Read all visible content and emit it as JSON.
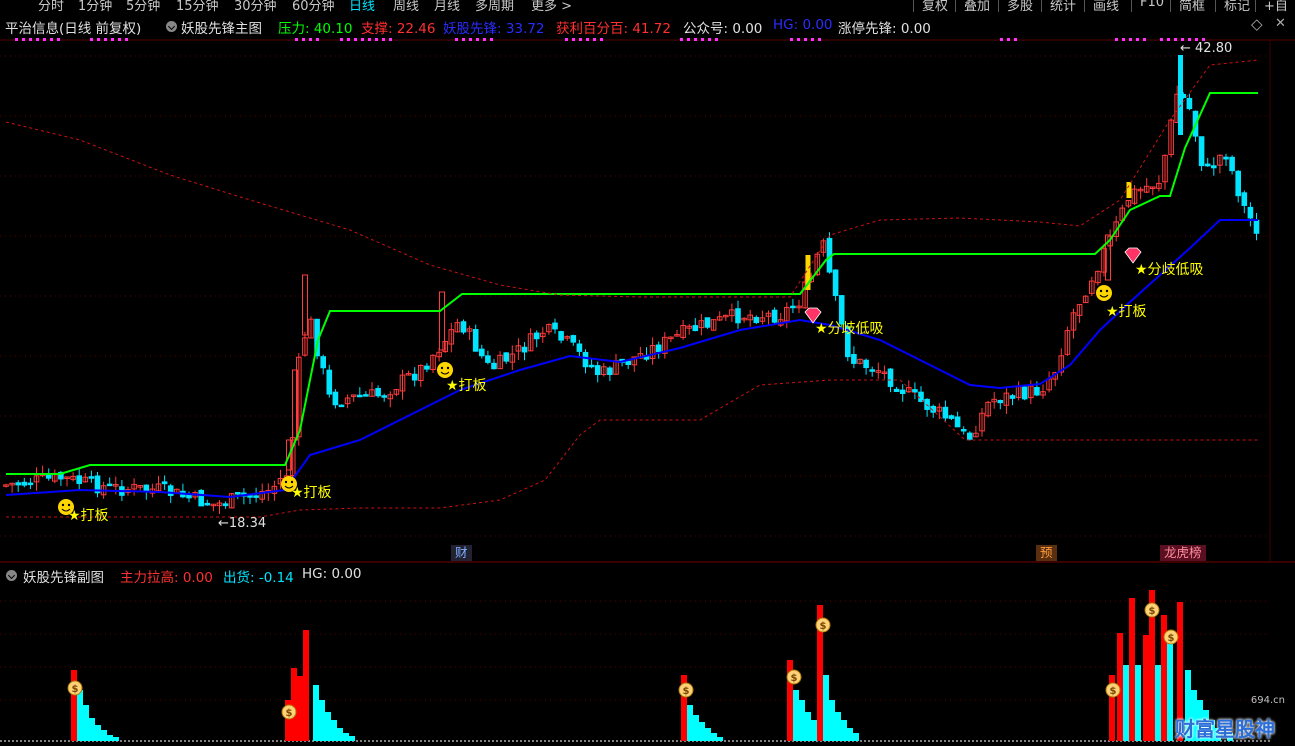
{
  "toolbar": {
    "periods": [
      "分时",
      "1分钟",
      "5分钟",
      "15分钟",
      "30分钟",
      "60分钟",
      "日线",
      "周线",
      "月线",
      "多周期",
      "更多 >"
    ],
    "active_period": "日线",
    "buttons": [
      "复权",
      "叠加",
      "多股",
      "统计",
      "画线",
      "F10",
      "简框",
      "标记",
      "+自选"
    ]
  },
  "main_header": {
    "stock": "平治信息(日线 前复权)",
    "indicator": "妖股先锋主图",
    "pressure": "压力: 40.10",
    "support": "支撑: 22.46",
    "yaogu": "妖股先锋: 33.72",
    "profit": "获利百分百: 41.72",
    "gzh": "公众号: 0.00",
    "hg": "HG: 0.00",
    "zt": "涨停先锋: 0.00"
  },
  "main_chart": {
    "max_label": "42.80",
    "min_label": "18.34",
    "signals": [
      {
        "text": "★打板"
      },
      {
        "text": "★打板"
      },
      {
        "text": "★打板"
      },
      {
        "text": "★分歧低吸"
      },
      {
        "text": "★打板"
      },
      {
        "text": "★分歧低吸"
      }
    ],
    "events": [
      {
        "text": "财"
      },
      {
        "text": "预"
      },
      {
        "text": "龙虎榜"
      }
    ]
  },
  "sub_header": {
    "indicator": "妖股先锋副图",
    "zhuli": "主力拉高: 0.00",
    "chuhuo": "出货: -0.14",
    "hg": "HG: 0.00"
  },
  "watermark": {
    "text": "财富星股神",
    "site": "694.cn"
  },
  "colors": {
    "up": "#ff3b3b",
    "down": "#00e4ff",
    "pressure": "#00ff00",
    "yaogu": "#0000ff",
    "support": "#ff2020",
    "yellow": "#ffff00",
    "magenta": "#ff33ff",
    "sub_red": "#ff0000",
    "sub_cyan": "#00ffff"
  }
}
